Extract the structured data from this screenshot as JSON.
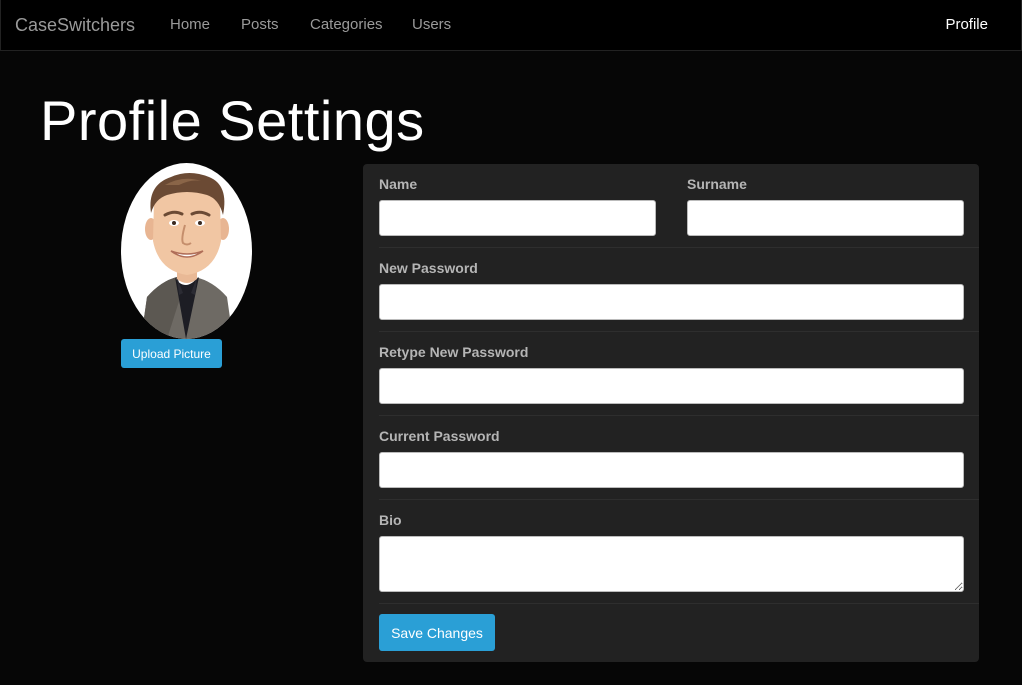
{
  "navbar": {
    "brand": "CaseSwitchers",
    "links": [
      "Home",
      "Posts",
      "Categories",
      "Users"
    ],
    "profile": "Profile"
  },
  "page": {
    "title": "Profile Settings"
  },
  "avatar": {
    "upload_label": "Upload Picture"
  },
  "form": {
    "name": {
      "label": "Name",
      "value": ""
    },
    "surname": {
      "label": "Surname",
      "value": ""
    },
    "new_password": {
      "label": "New Password",
      "value": ""
    },
    "retype_password": {
      "label": "Retype New Password",
      "value": ""
    },
    "current_password": {
      "label": "Current Password",
      "value": ""
    },
    "bio": {
      "label": "Bio",
      "value": ""
    },
    "save_label": "Save Changes"
  },
  "colors": {
    "accent": "#2a9fd6",
    "background": "#060606",
    "panel": "#222222",
    "navbar": "#000000"
  }
}
